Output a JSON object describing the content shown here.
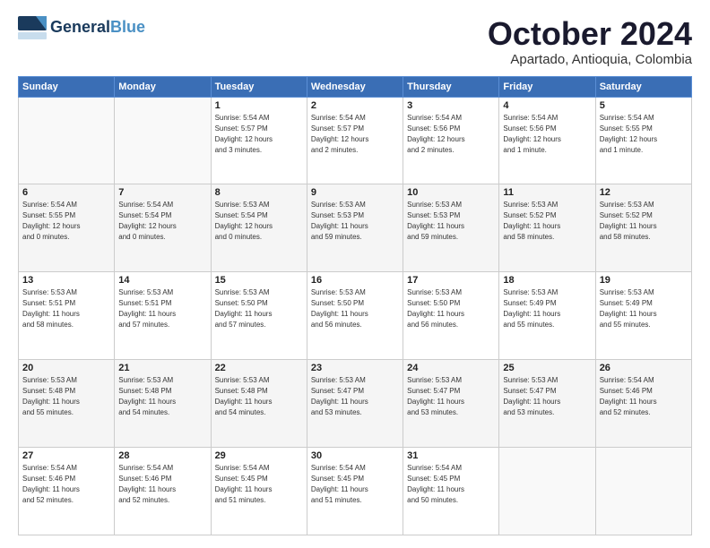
{
  "header": {
    "logo_line1": "General",
    "logo_line2": "Blue",
    "month": "October 2024",
    "location": "Apartado, Antioquia, Colombia"
  },
  "weekdays": [
    "Sunday",
    "Monday",
    "Tuesday",
    "Wednesday",
    "Thursday",
    "Friday",
    "Saturday"
  ],
  "weeks": [
    [
      {
        "day": "",
        "info": ""
      },
      {
        "day": "",
        "info": ""
      },
      {
        "day": "1",
        "info": "Sunrise: 5:54 AM\nSunset: 5:57 PM\nDaylight: 12 hours\nand 3 minutes."
      },
      {
        "day": "2",
        "info": "Sunrise: 5:54 AM\nSunset: 5:57 PM\nDaylight: 12 hours\nand 2 minutes."
      },
      {
        "day": "3",
        "info": "Sunrise: 5:54 AM\nSunset: 5:56 PM\nDaylight: 12 hours\nand 2 minutes."
      },
      {
        "day": "4",
        "info": "Sunrise: 5:54 AM\nSunset: 5:56 PM\nDaylight: 12 hours\nand 1 minute."
      },
      {
        "day": "5",
        "info": "Sunrise: 5:54 AM\nSunset: 5:55 PM\nDaylight: 12 hours\nand 1 minute."
      }
    ],
    [
      {
        "day": "6",
        "info": "Sunrise: 5:54 AM\nSunset: 5:55 PM\nDaylight: 12 hours\nand 0 minutes."
      },
      {
        "day": "7",
        "info": "Sunrise: 5:54 AM\nSunset: 5:54 PM\nDaylight: 12 hours\nand 0 minutes."
      },
      {
        "day": "8",
        "info": "Sunrise: 5:53 AM\nSunset: 5:54 PM\nDaylight: 12 hours\nand 0 minutes."
      },
      {
        "day": "9",
        "info": "Sunrise: 5:53 AM\nSunset: 5:53 PM\nDaylight: 11 hours\nand 59 minutes."
      },
      {
        "day": "10",
        "info": "Sunrise: 5:53 AM\nSunset: 5:53 PM\nDaylight: 11 hours\nand 59 minutes."
      },
      {
        "day": "11",
        "info": "Sunrise: 5:53 AM\nSunset: 5:52 PM\nDaylight: 11 hours\nand 58 minutes."
      },
      {
        "day": "12",
        "info": "Sunrise: 5:53 AM\nSunset: 5:52 PM\nDaylight: 11 hours\nand 58 minutes."
      }
    ],
    [
      {
        "day": "13",
        "info": "Sunrise: 5:53 AM\nSunset: 5:51 PM\nDaylight: 11 hours\nand 58 minutes."
      },
      {
        "day": "14",
        "info": "Sunrise: 5:53 AM\nSunset: 5:51 PM\nDaylight: 11 hours\nand 57 minutes."
      },
      {
        "day": "15",
        "info": "Sunrise: 5:53 AM\nSunset: 5:50 PM\nDaylight: 11 hours\nand 57 minutes."
      },
      {
        "day": "16",
        "info": "Sunrise: 5:53 AM\nSunset: 5:50 PM\nDaylight: 11 hours\nand 56 minutes."
      },
      {
        "day": "17",
        "info": "Sunrise: 5:53 AM\nSunset: 5:50 PM\nDaylight: 11 hours\nand 56 minutes."
      },
      {
        "day": "18",
        "info": "Sunrise: 5:53 AM\nSunset: 5:49 PM\nDaylight: 11 hours\nand 55 minutes."
      },
      {
        "day": "19",
        "info": "Sunrise: 5:53 AM\nSunset: 5:49 PM\nDaylight: 11 hours\nand 55 minutes."
      }
    ],
    [
      {
        "day": "20",
        "info": "Sunrise: 5:53 AM\nSunset: 5:48 PM\nDaylight: 11 hours\nand 55 minutes."
      },
      {
        "day": "21",
        "info": "Sunrise: 5:53 AM\nSunset: 5:48 PM\nDaylight: 11 hours\nand 54 minutes."
      },
      {
        "day": "22",
        "info": "Sunrise: 5:53 AM\nSunset: 5:48 PM\nDaylight: 11 hours\nand 54 minutes."
      },
      {
        "day": "23",
        "info": "Sunrise: 5:53 AM\nSunset: 5:47 PM\nDaylight: 11 hours\nand 53 minutes."
      },
      {
        "day": "24",
        "info": "Sunrise: 5:53 AM\nSunset: 5:47 PM\nDaylight: 11 hours\nand 53 minutes."
      },
      {
        "day": "25",
        "info": "Sunrise: 5:53 AM\nSunset: 5:47 PM\nDaylight: 11 hours\nand 53 minutes."
      },
      {
        "day": "26",
        "info": "Sunrise: 5:54 AM\nSunset: 5:46 PM\nDaylight: 11 hours\nand 52 minutes."
      }
    ],
    [
      {
        "day": "27",
        "info": "Sunrise: 5:54 AM\nSunset: 5:46 PM\nDaylight: 11 hours\nand 52 minutes."
      },
      {
        "day": "28",
        "info": "Sunrise: 5:54 AM\nSunset: 5:46 PM\nDaylight: 11 hours\nand 52 minutes."
      },
      {
        "day": "29",
        "info": "Sunrise: 5:54 AM\nSunset: 5:45 PM\nDaylight: 11 hours\nand 51 minutes."
      },
      {
        "day": "30",
        "info": "Sunrise: 5:54 AM\nSunset: 5:45 PM\nDaylight: 11 hours\nand 51 minutes."
      },
      {
        "day": "31",
        "info": "Sunrise: 5:54 AM\nSunset: 5:45 PM\nDaylight: 11 hours\nand 50 minutes."
      },
      {
        "day": "",
        "info": ""
      },
      {
        "day": "",
        "info": ""
      }
    ]
  ]
}
